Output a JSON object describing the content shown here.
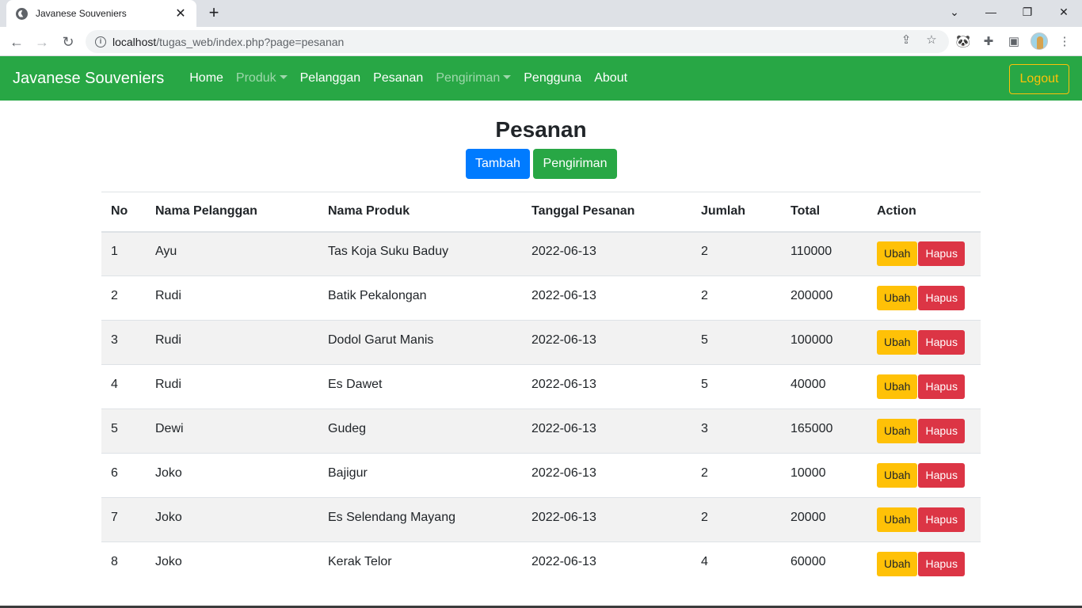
{
  "browser": {
    "tab_title": "Javanese Souveniers",
    "url_host": "localhost",
    "url_path": "/tugas_web/index.php?page=pesanan"
  },
  "navbar": {
    "brand": "Javanese Souveniers",
    "links": [
      "Home",
      "Produk",
      "Pelanggan",
      "Pesanan",
      "Pengiriman",
      "Pengguna",
      "About"
    ],
    "logout": "Logout"
  },
  "page": {
    "title": "Pesanan",
    "add_button": "Tambah",
    "shipping_button": "Pengiriman"
  },
  "table": {
    "headers": [
      "No",
      "Nama Pelanggan",
      "Nama Produk",
      "Tanggal Pesanan",
      "Jumlah",
      "Total",
      "Action"
    ],
    "rows": [
      {
        "no": "1",
        "pelanggan": "Ayu",
        "produk": "Tas Koja Suku Baduy",
        "tanggal": "2022-06-13",
        "jumlah": "2",
        "total": "110000"
      },
      {
        "no": "2",
        "pelanggan": "Rudi",
        "produk": "Batik Pekalongan",
        "tanggal": "2022-06-13",
        "jumlah": "2",
        "total": "200000"
      },
      {
        "no": "3",
        "pelanggan": "Rudi",
        "produk": "Dodol Garut Manis",
        "tanggal": "2022-06-13",
        "jumlah": "5",
        "total": "100000"
      },
      {
        "no": "4",
        "pelanggan": "Rudi",
        "produk": "Es Dawet",
        "tanggal": "2022-06-13",
        "jumlah": "5",
        "total": "40000"
      },
      {
        "no": "5",
        "pelanggan": "Dewi",
        "produk": "Gudeg",
        "tanggal": "2022-06-13",
        "jumlah": "3",
        "total": "165000"
      },
      {
        "no": "6",
        "pelanggan": "Joko",
        "produk": "Bajigur",
        "tanggal": "2022-06-13",
        "jumlah": "2",
        "total": "10000"
      },
      {
        "no": "7",
        "pelanggan": "Joko",
        "produk": "Es Selendang Mayang",
        "tanggal": "2022-06-13",
        "jumlah": "2",
        "total": "20000"
      },
      {
        "no": "8",
        "pelanggan": "Joko",
        "produk": "Kerak Telor",
        "tanggal": "2022-06-13",
        "jumlah": "4",
        "total": "60000"
      }
    ],
    "edit_label": "Ubah",
    "delete_label": "Hapus"
  }
}
